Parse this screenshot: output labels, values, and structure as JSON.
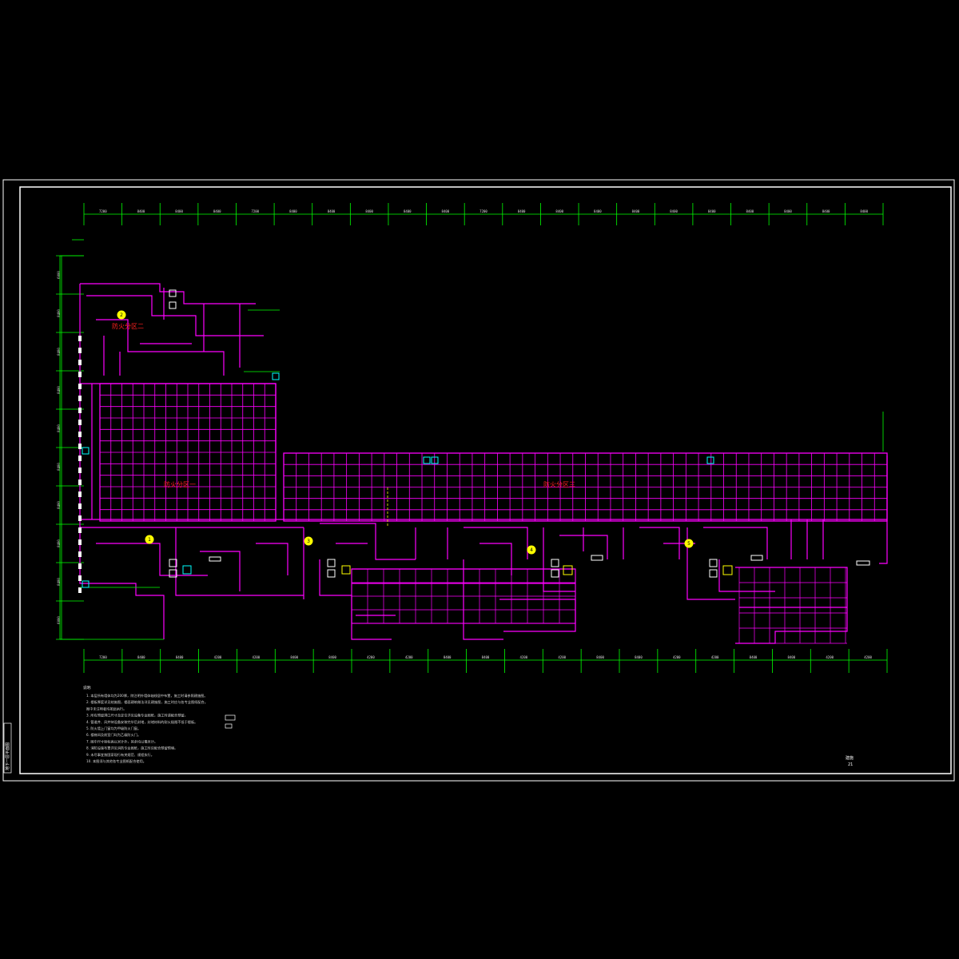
{
  "colors": {
    "background": "#000000",
    "border": "#ffffff",
    "grid": "#ff00ff",
    "dimension": "#00ff00",
    "zone_label": "#ff2020",
    "marker": "#ffff00",
    "equipment": "#00ffff"
  },
  "zones": [
    {
      "label": "防火分区二"
    },
    {
      "label": "防火分区一"
    },
    {
      "label": "防火分区三"
    }
  ],
  "top_dimensions": [
    "7200",
    "8400",
    "8400",
    "8400",
    "7200",
    "8400",
    "8400",
    "8400",
    "8400",
    "8400",
    "7200",
    "8400",
    "8400",
    "8400",
    "8400",
    "8400",
    "8400",
    "8400",
    "8400",
    "8400",
    "8400"
  ],
  "bottom_dimensions": [
    "7200",
    "8400",
    "8400",
    "4200",
    "4200",
    "8400",
    "8400",
    "4200",
    "4200",
    "8400",
    "8400",
    "4200",
    "4200",
    "8400",
    "8400",
    "4200",
    "4200",
    "8400",
    "8400",
    "4200",
    "4200"
  ],
  "left_dimensions": [
    "6000",
    "8400",
    "8400",
    "8400",
    "8400",
    "8400",
    "8400",
    "8400",
    "8400",
    "6000"
  ],
  "notes": {
    "heading": "说明:",
    "lines": [
      "1. 本层所有墙体均为200厚，除注明外墙体轴线居中布置，施工时请参照建施图。",
      "2. 楼板厚度详见结施图，楼面建筑做法详见建施图，施工时应与各专业图纸配合。",
      "   图中未注明者均按此执行。",
      "3. 所有预留洞口尺寸及定位详见设备专业图纸，施工时请配合预留。",
      "4. 管道井、风井待设备安装完毕后封堵，封堵材料的耐火极限不低于楼板。",
      "5. 防火墙上门窗均为甲级防火门窗。",
      "6. 楼梯间及前室门均为乙级防火门。",
      "7. 图中尺寸除标高以米计外，其余均以毫米计。",
      "8. 消防设施布置详见消防专业图纸，施工时应配合预留预埋。",
      "9. 未尽事宜按国家现行有关规范、规程执行。",
      "10. 本图须与其他各专业图纸配合使用。"
    ]
  },
  "title_block": {
    "drawing_number": "建施",
    "sheet": "21"
  },
  "side_strip": "地下一层平面图",
  "markers": [
    "2",
    "1",
    "3",
    "4",
    "5"
  ]
}
